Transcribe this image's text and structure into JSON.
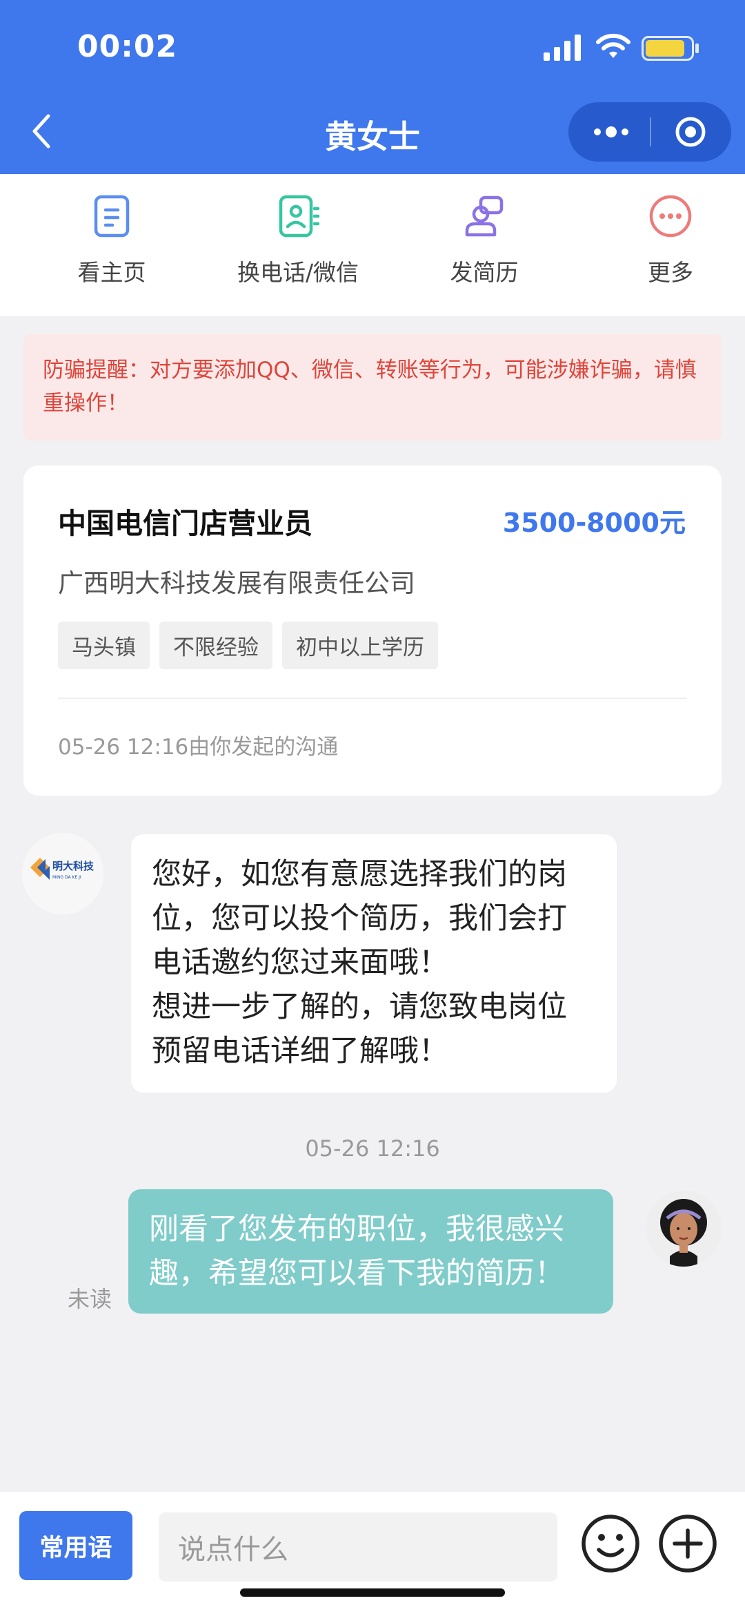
{
  "status_bar": {
    "time": "00:02"
  },
  "nav": {
    "title": "黄女士"
  },
  "actions": [
    {
      "label": "看主页",
      "icon": "document-icon",
      "color": "#5b8ef0"
    },
    {
      "label": "换电话/微信",
      "icon": "contact-card-icon",
      "color": "#36c6a0"
    },
    {
      "label": "发简历",
      "icon": "send-resume-icon",
      "color": "#8b72e6"
    },
    {
      "label": "更多",
      "icon": "more-circle-icon",
      "color": "#ef7a7a"
    }
  ],
  "warning": {
    "text": "防骗提醒：对方要添加QQ、微信、转账等行为，可能涉嫌诈骗，请慎重操作！"
  },
  "job": {
    "title": "中国电信门店营业员",
    "salary": "3500-8000元",
    "company": "广西明大科技发展有限责任公司",
    "tags": [
      "马头镇",
      "不限经验",
      "初中以上学历"
    ],
    "meta": "05-26 12:16由你发起的沟通"
  },
  "messages": {
    "incoming": {
      "line1": "您好，如您有意愿选择我们的岗位，您可以投个简历，我们会打电话邀约您过来面哦！",
      "line2": "想进一步了解的，请您致电岗位预留电话详细了解哦！"
    },
    "timestamp": "05-26 12:16",
    "outgoing": {
      "text": "刚看了您发布的职位，我很感兴趣，希望您可以看下我的简历！",
      "status": "未读"
    }
  },
  "company_logo": {
    "text": "明大科技",
    "subtext": "MING DA KE JI"
  },
  "input_bar": {
    "phrases_label": "常用语",
    "placeholder": "说点什么"
  },
  "colors": {
    "accent": "#3f77ec",
    "outgoing_bubble": "#7fccca",
    "warning": "#e0453a"
  }
}
